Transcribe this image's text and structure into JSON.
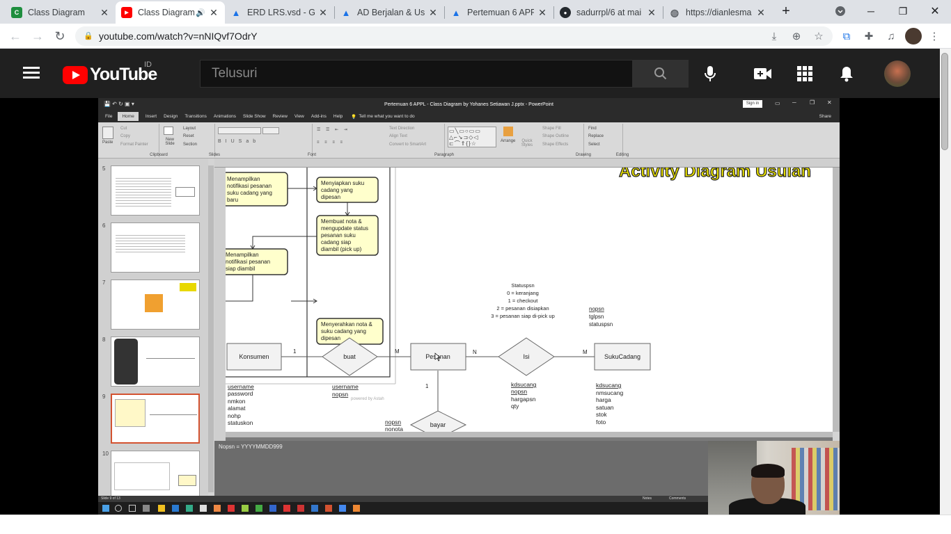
{
  "tabs": [
    {
      "title": "Class Diagram",
      "icon": "google-classroom-icon",
      "color": "#1e8e3e",
      "glyph": "C"
    },
    {
      "title": "Class Diagram",
      "icon": "youtube-icon",
      "color": "#ff0000",
      "glyph": "▶",
      "audio": "🔊"
    },
    {
      "title": "ERD LRS.vsd - Goo",
      "icon": "google-drive-icon",
      "color": "#1a73e8",
      "glyph": "▲"
    },
    {
      "title": "AD Berjalan & Us",
      "icon": "google-drive-icon",
      "color": "#1a73e8",
      "glyph": "▲"
    },
    {
      "title": "Pertemuan 6 APPL",
      "icon": "google-drive-icon",
      "color": "#1a73e8",
      "glyph": "▲"
    },
    {
      "title": "sadurrpl/6 at mai",
      "icon": "github-icon",
      "color": "#24292e",
      "glyph": "●"
    },
    {
      "title": "https://dianlesma",
      "icon": "globe-icon",
      "color": "#5f6368",
      "glyph": "◍"
    }
  ],
  "address_bar": {
    "url": "youtube.com/watch?v=nNIQvf7OdrY"
  },
  "youtube": {
    "logo_text": "YouTube",
    "country": "ID",
    "search_placeholder": "Telusuri"
  },
  "powerpoint": {
    "window_title": "Pertemuan 6 APPL - Class Diagram by Yohanes Setiawan J.pptx - PowerPoint",
    "sign_in": "Sign in",
    "share": "Share",
    "menu": [
      "File",
      "Home",
      "Insert",
      "Design",
      "Transitions",
      "Animations",
      "Slide Show",
      "Review",
      "View",
      "Add-ins",
      "Help"
    ],
    "tell_me": "Tell me what you want to do",
    "ribbon_groups": [
      "Clipboard",
      "Slides",
      "Font",
      "Paragraph",
      "Drawing",
      "Editing"
    ],
    "ribbon_items": {
      "paste": "Paste",
      "cut": "Cut",
      "copy": "Copy",
      "format_painter": "Format Painter",
      "new_slide": "New Slide",
      "layout": "Layout",
      "reset": "Reset",
      "section": "Section",
      "text_direction": "Text Direction",
      "align_text": "Align Text",
      "convert_smartart": "Convert to SmartArt",
      "arrange": "Arrange",
      "quick_styles": "Quick Styles",
      "shape_fill": "Shape Fill",
      "shape_outline": "Shape Outline",
      "shape_effects": "Shape Effects",
      "find": "Find",
      "replace": "Replace",
      "select": "Select"
    },
    "thumb_numbers": [
      "5",
      "6",
      "7",
      "8",
      "9",
      "10"
    ],
    "slide_title": "Activity Diagram Usulan",
    "powered_by": "powered by Astah",
    "notes_text": "Nopsn = YYYYMMDD999",
    "status_left": "Slide 9 of 13",
    "status_notes": "Notes",
    "status_comments": "Comments"
  },
  "activity": {
    "a1": [
      "Menampilkan",
      "notifikasi pesanan",
      "suku cadang yang",
      "baru"
    ],
    "a2": [
      "Menyiapkan suku",
      "cadang yang",
      "dipesan"
    ],
    "a3": [
      "Membuat nota &",
      "mengupdate status",
      "pesanan suku",
      "cadang siap",
      "diambil (pick up)"
    ],
    "a4": [
      "Menampilkan",
      "notifikasi pesanan",
      "siap diambil"
    ],
    "a5": [
      "Menyerahkan nota &",
      "suku cadang yang",
      "dipesan"
    ]
  },
  "erd": {
    "status_note": [
      "Statuspsn",
      "0 = keranjang",
      "1 = checkout",
      "2 = pesanan disiapkan",
      "3 = pesanan siap di-pick up"
    ],
    "entities": {
      "konsumen": "Konsumen",
      "pesanan": "Pesanan",
      "sukucadang": "SukuCadang"
    },
    "relations": {
      "buat": "buat",
      "isi": "Isi",
      "bayar": "bayar"
    },
    "cardinality": {
      "k_buat": "1",
      "buat_p": "M",
      "p_isi": "N",
      "isi_s": "M",
      "p_bayar": "1"
    },
    "konsumen_attrs": [
      "username",
      "password",
      "nmkon",
      "alamat",
      "nohp",
      "statuskon"
    ],
    "buat_attrs": [
      "username",
      "nopsn"
    ],
    "pesanan_attrs": [
      "nopsn",
      "tglpsn",
      "statuspsn"
    ],
    "isi_attrs": [
      "kdsucang",
      "nopsn",
      "hargapsn",
      "qty"
    ],
    "sukucadang_attrs": [
      "kdsucang",
      "nmsucang",
      "harga",
      "satuan",
      "stok",
      "foto"
    ],
    "bayar_attrs": [
      "nopsn",
      "nonota"
    ]
  }
}
